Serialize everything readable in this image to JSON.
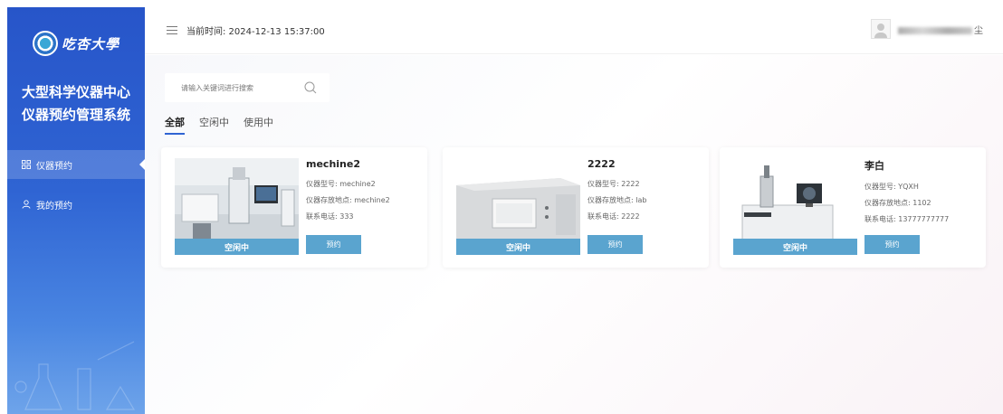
{
  "sidebar": {
    "logo_text": "吃杏大學",
    "system_title_line1": "大型科学仪器中心",
    "system_title_line2": "仪器预约管理系统",
    "items": [
      {
        "label": "仪器预约",
        "icon": "grid-icon",
        "active": true
      },
      {
        "label": "我的预约",
        "icon": "user-icon",
        "active": false
      }
    ]
  },
  "header": {
    "time_label": "当前时间: 2024-12-13 15:37:00",
    "user_suffix": "尘"
  },
  "search": {
    "placeholder": "请输入关键词进行搜索"
  },
  "tabs": [
    {
      "label": "全部",
      "active": true
    },
    {
      "label": "空闲中",
      "active": false
    },
    {
      "label": "使用中",
      "active": false
    }
  ],
  "instruments": [
    {
      "name": "mechine2",
      "model": "仪器型号: mechine2",
      "location": "仪器存放地点: mechine2",
      "phone": "联系电话: 333",
      "status": "空闲中",
      "button": "预约"
    },
    {
      "name": "2222",
      "model": "仪器型号: 2222",
      "location": "仪器存放地点: lab",
      "phone": "联系电话: 2222",
      "status": "空闲中",
      "button": "预约"
    },
    {
      "name": "李白",
      "model": "仪器型号: YQXH",
      "location": "仪器存放地点: 1102",
      "phone": "联系电话: 13777777777",
      "status": "空闲中",
      "button": "预约"
    }
  ],
  "colors": {
    "sidebar_top": "#2755c9",
    "accent": "#5aa4cf",
    "primary": "#2f64d3"
  }
}
